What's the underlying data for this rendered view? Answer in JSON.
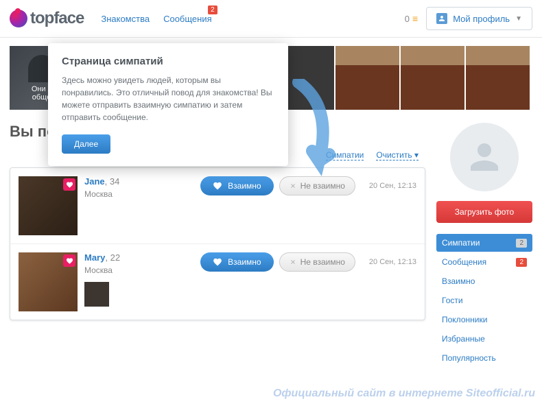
{
  "header": {
    "logo_text": "topface",
    "nav": {
      "dating": "Знакомства",
      "messages": "Сообщения",
      "messages_badge": "2"
    },
    "currency": "0",
    "profile_label": "Мой профиль"
  },
  "photo_strip": {
    "first_tile_line1": "Они х",
    "first_tile_line2": "обще"
  },
  "page_title": "Вы по",
  "tabs": {
    "new": "Симпатии",
    "clear": "Очистить"
  },
  "cards": [
    {
      "name": "Jane",
      "age": "34",
      "city": "Москва",
      "mutual_label": "Взаимно",
      "not_mutual_label": "Не взаимно",
      "date": "20 Сен, 12:13",
      "has_small_photo": false
    },
    {
      "name": "Mary",
      "age": "22",
      "city": "Москва",
      "mutual_label": "Взаимно",
      "not_mutual_label": "Не взаимно",
      "date": "20 Сен, 12:13",
      "has_small_photo": true
    }
  ],
  "sidebar": {
    "upload_label": "Загрузить фото",
    "items": [
      {
        "label": "Симпатии",
        "badge": "2",
        "badge_type": "gray",
        "active": true
      },
      {
        "label": "Сообщения",
        "badge": "2",
        "badge_type": "red",
        "active": false
      },
      {
        "label": "Взаимно",
        "badge": "",
        "active": false
      },
      {
        "label": "Гости",
        "badge": "",
        "active": false
      },
      {
        "label": "Поклонники",
        "badge": "",
        "active": false
      },
      {
        "label": "Избранные",
        "badge": "",
        "active": false
      },
      {
        "label": "Популярность",
        "badge": "",
        "active": false
      }
    ]
  },
  "tooltip": {
    "title": "Страница симпатий",
    "text": "Здесь можно увидеть людей, которым вы понравились. Это отличный повод для знакомства! Вы можете отправить взаимную симпатию и затем отправить сообщение.",
    "button": "Далее"
  },
  "watermark": "Официальный сайт в интернете Siteofficial.ru"
}
